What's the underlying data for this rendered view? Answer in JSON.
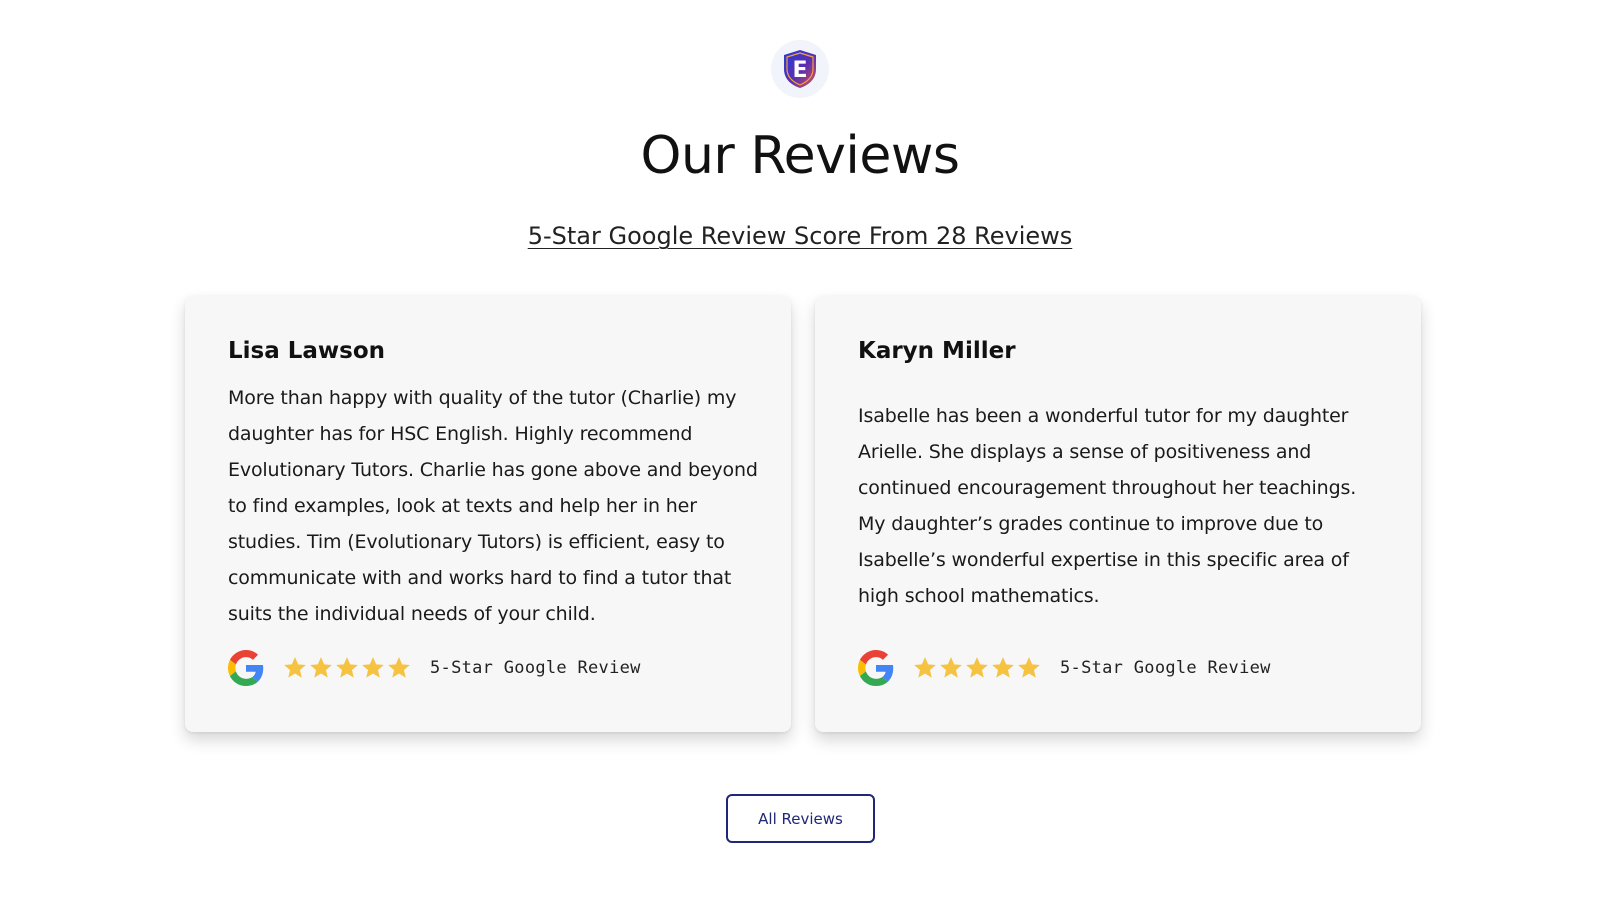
{
  "header": {
    "logo_letter": "E",
    "logo_icon": "shield-e-logo",
    "title": "Our Reviews",
    "subtitle_link": "5-Star Google Review Score From 28 Reviews"
  },
  "reviews": [
    {
      "name": "Lisa Lawson",
      "text": "More than happy with quality of the tutor (Charlie) my daughter has for HSC English. Highly recommend Evolutionary Tutors. Charlie has gone above and beyond to find examples, look at texts and help her in her studies. Tim (Evolutionary Tutors) is efficient, easy to communicate with and works hard to find a tutor that suits the individual needs of your child.",
      "rating": 5,
      "rating_max": 5,
      "rating_label": "5-Star Google Review",
      "source_icon": "google-icon"
    },
    {
      "name": "Karyn Miller",
      "text": "Isabelle has been a wonderful tutor for my daughter Arielle. She displays a sense of positiveness and continued encouragement throughout her teachings. My daughter’s grades continue to improve due to Isabelle’s wonderful expertise in this specific area of high school mathematics.",
      "rating": 5,
      "rating_max": 5,
      "rating_label": "5-Star Google Review",
      "source_icon": "google-icon"
    }
  ],
  "actions": {
    "all_reviews_label": "All Reviews"
  },
  "colors": {
    "star": "#f5c242",
    "button_border": "#1f2778",
    "card_bg": "#f7f7f7",
    "logo_gradient_start": "#3b2fb8",
    "logo_gradient_end": "#e5524a"
  }
}
